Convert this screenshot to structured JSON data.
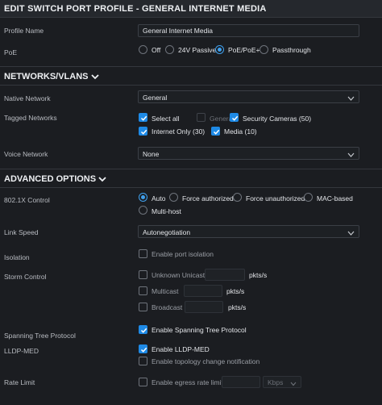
{
  "header": {
    "title": "EDIT SWITCH PORT PROFILE - GENERAL INTERNET MEDIA"
  },
  "profile_name": {
    "label": "Profile Name",
    "value": "General Internet Media"
  },
  "poe": {
    "label": "PoE",
    "options": [
      "Off",
      "24V Passive",
      "PoE/PoE+",
      "Passthrough"
    ],
    "selected": "PoE/PoE+"
  },
  "networks": {
    "section_title": "NETWORKS/VLANS",
    "native": {
      "label": "Native Network",
      "value": "General"
    },
    "tagged": {
      "label": "Tagged Networks",
      "select_all": "Select all",
      "general": "General",
      "security_cameras": "Security Cameras (50)",
      "internet_only": "Internet Only (30)",
      "media": "Media (10)"
    },
    "voice": {
      "label": "Voice Network",
      "value": "None"
    }
  },
  "advanced": {
    "section_title": "ADVANCED OPTIONS",
    "dot1x": {
      "label": "802.1X Control",
      "options": [
        "Auto",
        "Force authorized",
        "Force unauthorized",
        "MAC-based",
        "Multi-host"
      ],
      "selected": "Auto"
    },
    "link_speed": {
      "label": "Link Speed",
      "value": "Autonegotiation"
    },
    "isolation": {
      "label": "Isolation",
      "option": "Enable port isolation"
    },
    "storm": {
      "label": "Storm Control",
      "unknown_unicast": "Unknown Unicast",
      "multicast": "Multicast",
      "broadcast": "Broadcast",
      "unit": "pkts/s"
    },
    "stp": {
      "label": "Spanning Tree Protocol",
      "option": "Enable Spanning Tree Protocol"
    },
    "lldp": {
      "label": "LLDP-MED",
      "option": "Enable LLDP-MED",
      "topology": "Enable topology change notification"
    },
    "rate_limit": {
      "label": "Rate Limit",
      "option": "Enable egress rate limit",
      "unit": "Kbps"
    }
  },
  "colors": {
    "accent": "#1e8ae6",
    "background": "#1b1d21"
  }
}
